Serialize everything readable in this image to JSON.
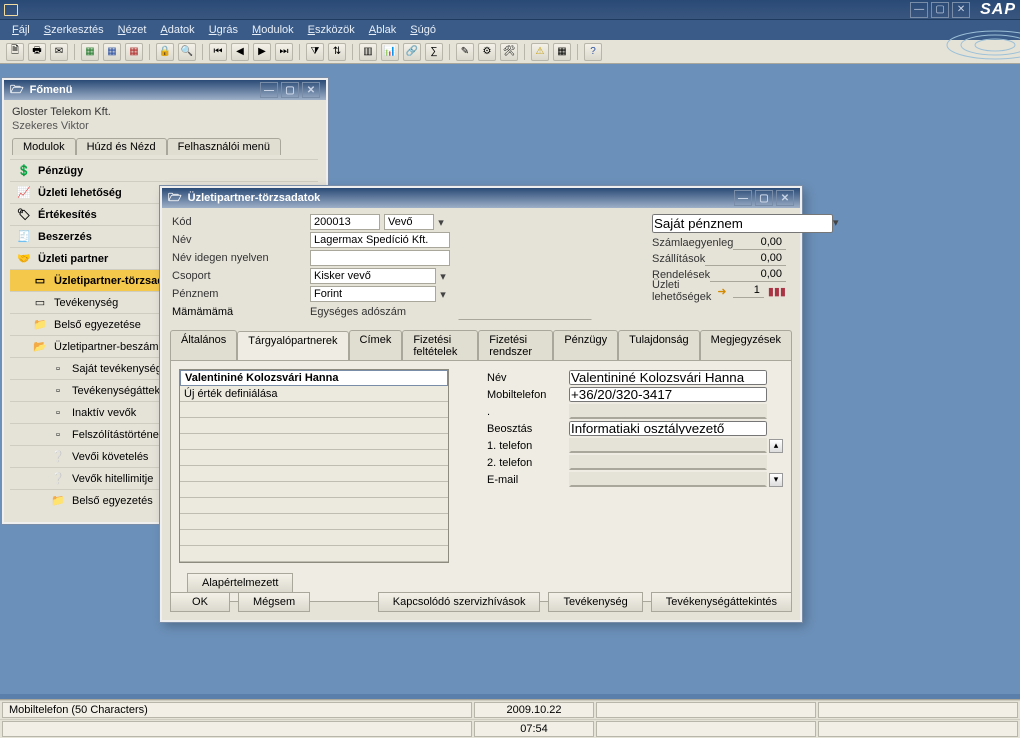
{
  "app": {
    "sap_logo": "SAP"
  },
  "menu": {
    "items": [
      "Fájl",
      "Szerkesztés",
      "Nézet",
      "Adatok",
      "Ugrás",
      "Modulok",
      "Eszközök",
      "Ablak",
      "Súgó"
    ]
  },
  "main_menu_window": {
    "title": "Főmenü",
    "company": "Gloster Telekom Kft.",
    "user": "Szekeres Viktor",
    "tabs": [
      "Modulok",
      "Húzd és Nézd",
      "Felhasználói menü"
    ],
    "tree": [
      {
        "label": "Pénzügy",
        "icon": "💲",
        "top": true
      },
      {
        "label": "Üzleti lehetőség",
        "icon": "📈",
        "top": true
      },
      {
        "label": "Értékesítés",
        "icon": "🏷",
        "top": true
      },
      {
        "label": "Beszerzés",
        "icon": "🧾",
        "top": true
      },
      {
        "label": "Üzleti partner",
        "icon": "🤝",
        "top": true
      },
      {
        "label": "Üzletipartner-törzsadatok",
        "icon": "▭",
        "sel": true,
        "lvl": 1
      },
      {
        "label": "Tevékenység",
        "icon": "▭",
        "lvl": 1
      },
      {
        "label": "Belső egyezetése",
        "icon": "📁",
        "lvl": 1
      },
      {
        "label": "Üzletipartner-beszámoló",
        "icon": "📂",
        "lvl": 1
      },
      {
        "label": "Saját tevékenység",
        "icon": "▫",
        "lvl": 2
      },
      {
        "label": "Tevékenységáttekintés",
        "icon": "▫",
        "lvl": 2
      },
      {
        "label": "Inaktív vevők",
        "icon": "▫",
        "lvl": 2
      },
      {
        "label": "Felszólítástörténet",
        "icon": "▫",
        "lvl": 2
      },
      {
        "label": "Vevői követelés",
        "icon": "❔",
        "lvl": 2
      },
      {
        "label": "Vevők hitellimitje",
        "icon": "❔",
        "lvl": 2
      },
      {
        "label": "Belső egyezetés",
        "icon": "📁",
        "lvl": 2
      }
    ]
  },
  "modal": {
    "title": "Üzletipartner-törzsadatok",
    "top_form": {
      "kod_label": "Kód",
      "kod_value": "200013",
      "kod_type": "Vevő",
      "nev_label": "Név",
      "nev_value": "Lagermax Spedíció Kft.",
      "idegen_label": "Név idegen nyelven",
      "idegen_value": "",
      "csoport_label": "Csoport",
      "csoport_value": "Kisker vevő",
      "penznem_label": "Pénznem",
      "penznem_value": "Forint",
      "adoszam_label": "Egységes adószám",
      "adoszam_value": ""
    },
    "summary": {
      "currency_mode": "Saját pénznem",
      "rows": [
        {
          "label": "Számlaegyenleg",
          "value": "0,00"
        },
        {
          "label": "Szállítások",
          "value": "0,00"
        },
        {
          "label": "Rendelések",
          "value": "0,00"
        },
        {
          "label": "Üzleti lehetőségek",
          "value": "1",
          "chart": true
        }
      ]
    },
    "tabs": [
      "Általános",
      "Tárgyalópartnerek",
      "Címek",
      "Fizetési feltételek",
      "Fizetési rendszer",
      "Pénzügy",
      "Tulajdonság",
      "Megjegyzések"
    ],
    "active_tab": "Tárgyalópartnerek",
    "contact_list": [
      "Valentininé Kolozsvári Hanna",
      "Új érték definiálása",
      "",
      "",
      "",
      "",
      "",
      "",
      "",
      "",
      "",
      ""
    ],
    "contact_detail": {
      "nev_label": "Név",
      "nev_value": "Valentininé Kolozsvári Hanna",
      "mobil_label": "Mobiltelefon",
      "mobil_value": "+36/20/320-3417",
      "dot_label": ".",
      "dot_value": "",
      "beosztas_label": "Beosztás",
      "beosztas_value": "Informatiaki osztályvezető",
      "tel1_label": "1. telefon",
      "tel1_value": "",
      "tel2_label": "2. telefon",
      "tel2_value": "",
      "email_label": "E-mail",
      "email_value": ""
    },
    "default_btn": "Alapértelmezett",
    "buttons": {
      "ok": "OK",
      "cancel": "Mégsem",
      "b1": "Kapcsolódó szervizhívások",
      "b2": "Tevékenység",
      "b3": "Tevékenységáttekintés"
    }
  },
  "statusbar": {
    "msg": "Mobiltelefon (50 Characters)",
    "date": "2009.10.22",
    "time": "07:54"
  }
}
